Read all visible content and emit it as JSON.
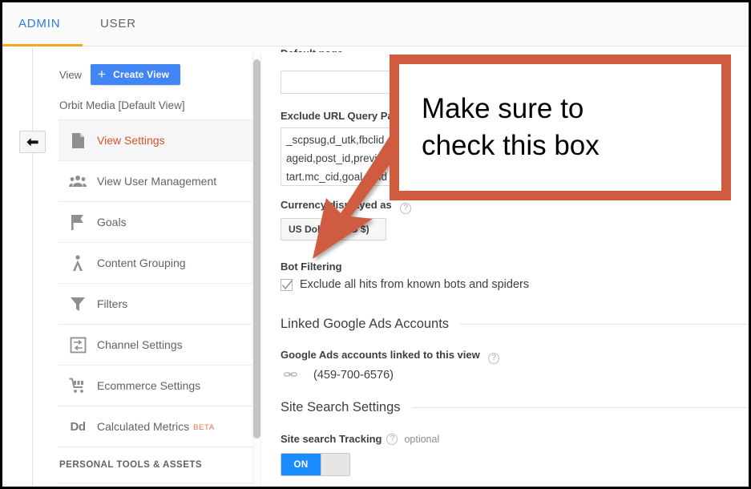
{
  "tabs": [
    {
      "label": "ADMIN",
      "active": true
    },
    {
      "label": "USER",
      "active": false
    }
  ],
  "sidebar": {
    "view_label": "View",
    "create_view_button": "Create View",
    "create_view_plus": "+",
    "view_name": "Orbit Media [Default View]",
    "items": [
      {
        "label": "View Settings",
        "icon": "document-icon",
        "active": true
      },
      {
        "label": "View User Management",
        "icon": "people-icon",
        "active": false
      },
      {
        "label": "Goals",
        "icon": "flag-icon",
        "active": false
      },
      {
        "label": "Content Grouping",
        "icon": "content-grouping-icon",
        "active": false
      },
      {
        "label": "Filters",
        "icon": "funnel-icon",
        "active": false
      },
      {
        "label": "Channel Settings",
        "icon": "channel-icon",
        "active": false
      },
      {
        "label": "Ecommerce Settings",
        "icon": "cart-icon",
        "active": false
      },
      {
        "label": "Calculated Metrics",
        "icon": "dd-icon",
        "badge": "BETA",
        "active": false
      }
    ],
    "section_header": "PERSONAL TOOLS & ASSETS"
  },
  "back_button": {
    "icon": "back-arrow-icon"
  },
  "main": {
    "top_field_value": "",
    "exclude_query_label": "Exclude URL Query Parameters",
    "exclude_query_value": "_scpsug,d_utk,fbclid\nageid,post_id,preview\ntart.mc_cid,goal,sslid",
    "currency_label": "Currency displayed as",
    "currency_value": "US Dollar (USD $)",
    "bot_filtering_label": "Bot Filtering",
    "bot_filtering_checkbox": "Exclude all hits from known bots and spiders",
    "bot_filtering_checked": true,
    "linked_ads_section": "Linked Google Ads Accounts",
    "linked_ads_label": "Google Ads accounts linked to this view",
    "linked_ads_account": "(459-700-6576)",
    "site_search_section": "Site Search Settings",
    "site_search_label": "Site search Tracking",
    "site_search_optional": "optional",
    "site_search_toggle": "ON",
    "help_glyph": "?"
  },
  "annotation": {
    "line1": "Make sure to",
    "line2": "check this box",
    "border_color": "#cf5c3f"
  }
}
